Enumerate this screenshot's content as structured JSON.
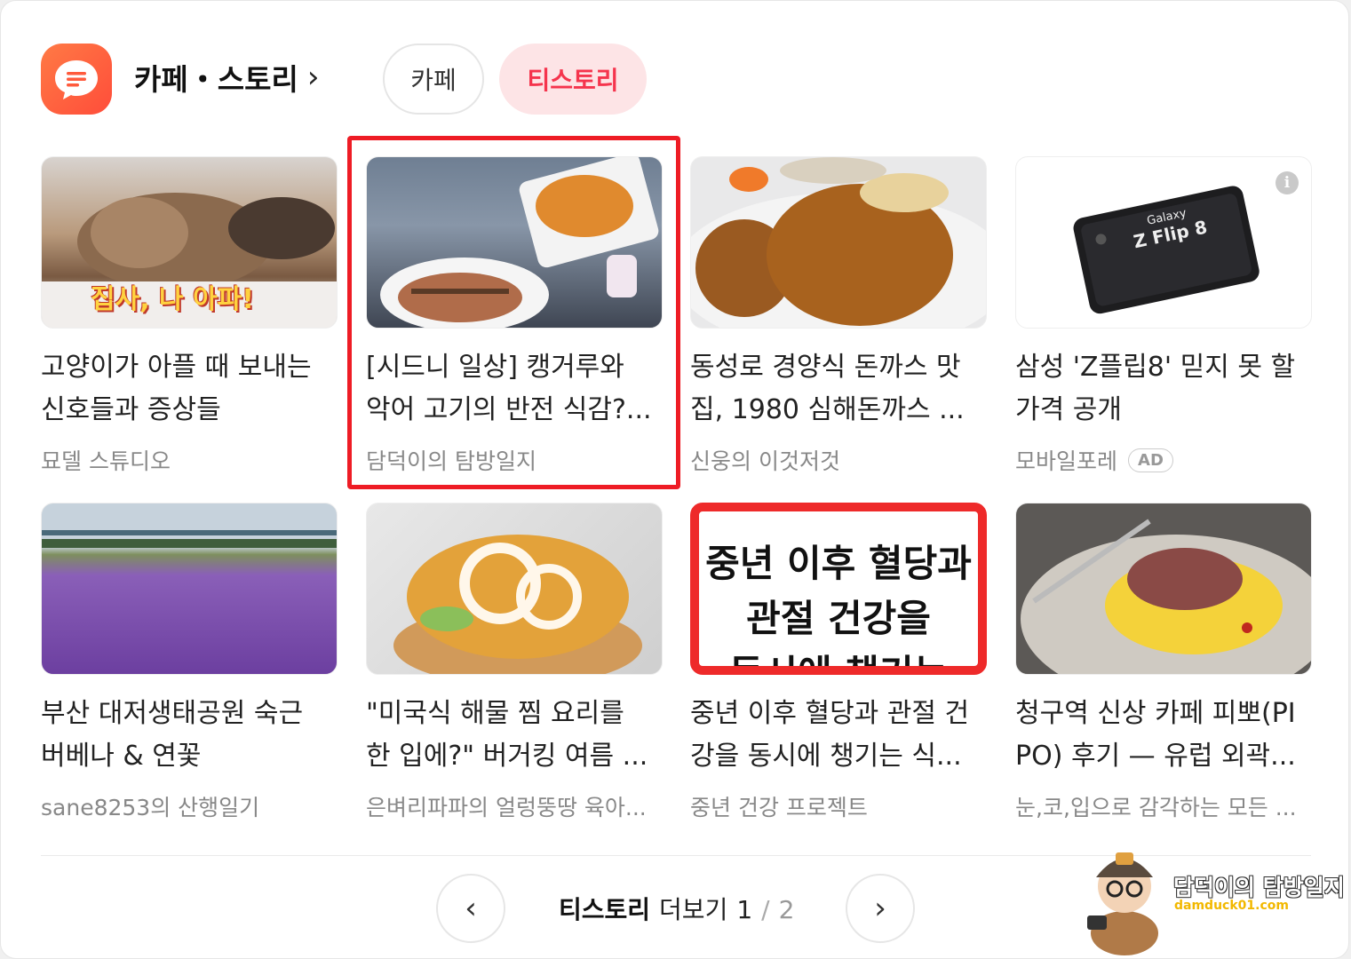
{
  "header": {
    "title": "카페・스토리",
    "chevron": "›",
    "tabs": [
      {
        "label": "카페",
        "selected": false
      },
      {
        "label": "티스토리",
        "selected": true
      }
    ]
  },
  "cards": [
    {
      "title_line1": "고양이가 아플 때 보내는",
      "title_line2": "신호들과 증상들",
      "source": "묘델 스튜디오",
      "thumb_caption": "집사, 나 아파!"
    },
    {
      "title_line1": "[시드니 일상] 캥거루와",
      "title_line2": "악어 고기의 반전 식감?...",
      "source": "담덕이의 탐방일지"
    },
    {
      "title_line1": "동성로 경양식 돈까스 맛",
      "title_line2": "집, 1980 심해돈까스 ...",
      "source": "신웅의 이것저것"
    },
    {
      "title_line1": "삼성 'Z플립8' 믿지 못 할",
      "title_line2": "가격 공개",
      "source": "모바일포레",
      "badge": "AD",
      "thumb_caption1": "Galaxy",
      "thumb_caption2": "Z Flip 8"
    },
    {
      "title_line1": "부산 대저생태공원 숙근",
      "title_line2": "버베나 & 연꽃",
      "source": "sane8253의 산행일기"
    },
    {
      "title_line1": "\"미국식 해물 찜 요리를",
      "title_line2": "한 입에?\" 버거킹 여름 ...",
      "source": "은벼리파파의 얼렁뚱땅 육아..."
    },
    {
      "title_line1": "중년 이후 혈당과 관절 건",
      "title_line2": "강을 동시에 챙기는 식...",
      "source": "중년 건강 프로젝트",
      "thumb_caption1": "중년 이후 혈당과",
      "thumb_caption2": "관절 건강을",
      "thumb_caption3": "동시에 챙기는"
    },
    {
      "title_line1": "청구역 신상 카페 피뽀(PI",
      "title_line2": "PO) 후기 — 유럽 외곽...",
      "source": "눈,코,입으로 감각하는 모든 ..."
    }
  ],
  "pager": {
    "prev": "‹",
    "label_bold": "티스토리",
    "label": "더보기",
    "current": "1",
    "separator": "/",
    "total": "2",
    "next": "›"
  },
  "watermark": {
    "title": "담덕이의 탐방일지",
    "url": "damduck01.com"
  },
  "colors": {
    "accent": "#f5344d",
    "highlight_box": "#ee1c25",
    "app_icon": "#ff5a3c"
  }
}
